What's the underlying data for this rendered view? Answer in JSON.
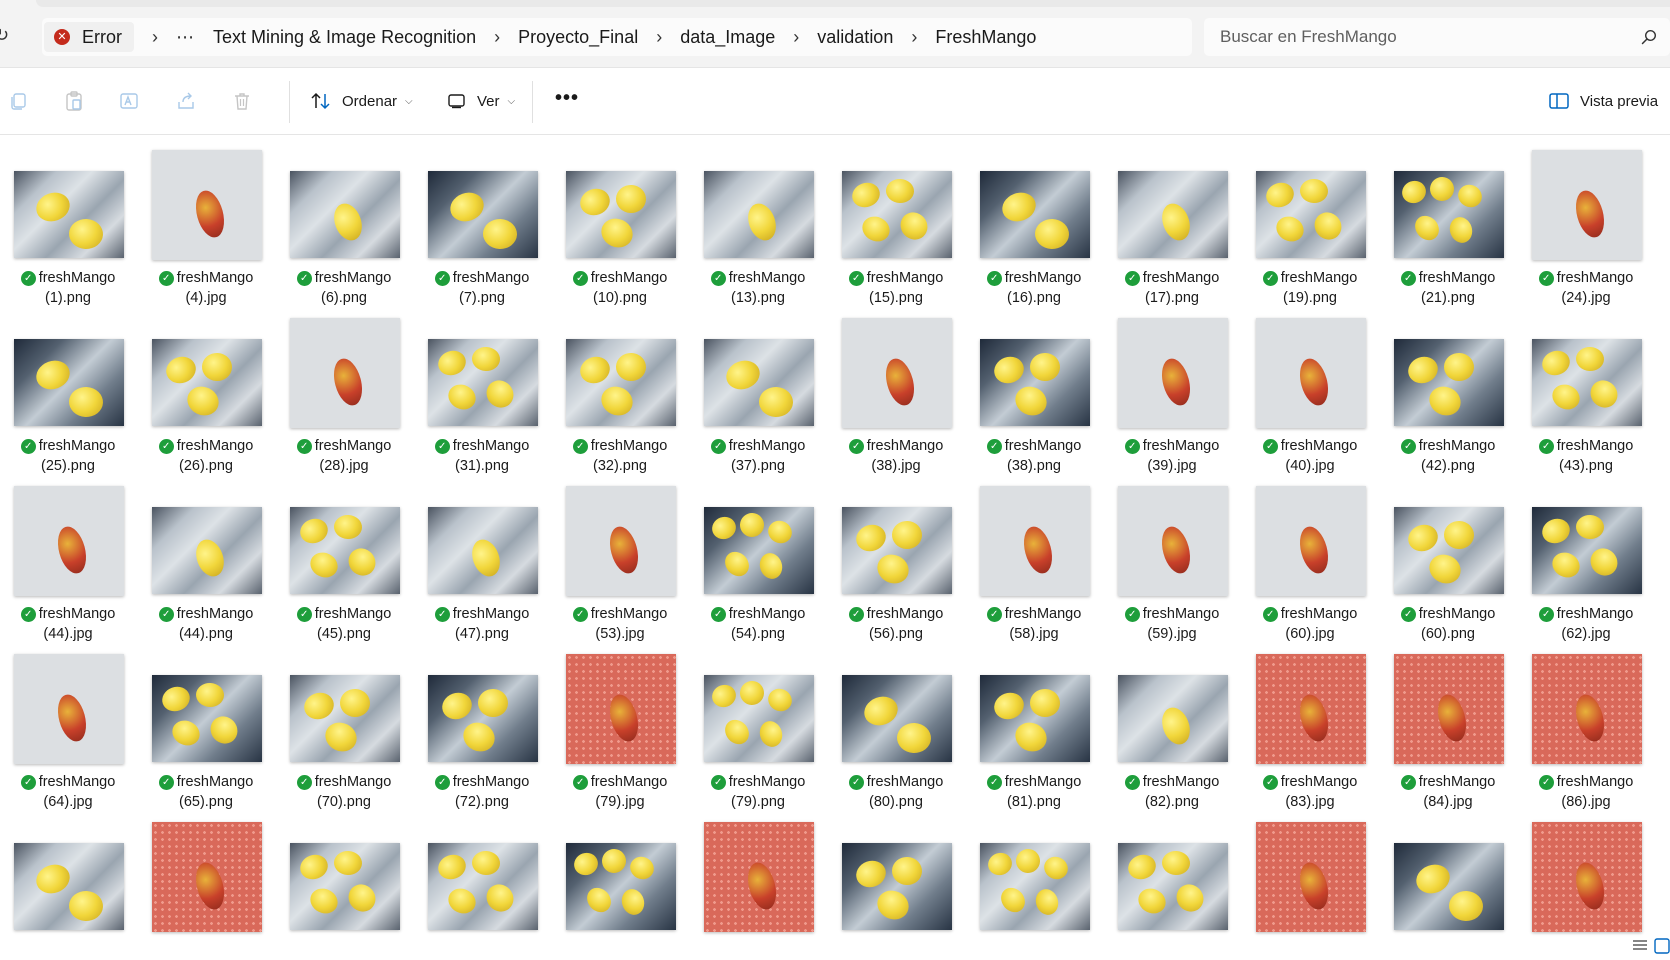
{
  "address_bar": {
    "error_label": "Error",
    "more_label": "⋯",
    "crumbs": [
      "Text Mining & Image Recognition",
      "Proyecto_Final",
      "data_Image",
      "validation",
      "FreshMango"
    ],
    "search_placeholder": "Buscar en FreshMango"
  },
  "command_bar": {
    "sort_label": "Ordenar",
    "view_label": "Ver",
    "more_label": "•••",
    "preview_label": "Vista previa"
  },
  "files": [
    {
      "name": "freshMango",
      "ext": "(1).png",
      "scene": "tray",
      "fruits": 2
    },
    {
      "name": "freshMango",
      "ext": "(4).jpg",
      "scene": "white",
      "fruits": 1
    },
    {
      "name": "freshMango",
      "ext": "(6).png",
      "scene": "tray",
      "fruits": 1
    },
    {
      "name": "freshMango",
      "ext": "(7).png",
      "scene": "tray-dark",
      "fruits": 2
    },
    {
      "name": "freshMango",
      "ext": "(10).png",
      "scene": "tray",
      "fruits": 3
    },
    {
      "name": "freshMango",
      "ext": "(13).png",
      "scene": "tray",
      "fruits": 1
    },
    {
      "name": "freshMango",
      "ext": "(15).png",
      "scene": "tray",
      "fruits": 4
    },
    {
      "name": "freshMango",
      "ext": "(16).png",
      "scene": "tray-dark",
      "fruits": 2
    },
    {
      "name": "freshMango",
      "ext": "(17).png",
      "scene": "tray",
      "fruits": 1
    },
    {
      "name": "freshMango",
      "ext": "(19).png",
      "scene": "tray",
      "fruits": 4
    },
    {
      "name": "freshMango",
      "ext": "(21).png",
      "scene": "tray-dark",
      "fruits": 5
    },
    {
      "name": "freshMango",
      "ext": "(24).jpg",
      "scene": "white",
      "fruits": 1
    },
    {
      "name": "freshMango",
      "ext": "(25).png",
      "scene": "tray-dark",
      "fruits": 2
    },
    {
      "name": "freshMango",
      "ext": "(26).png",
      "scene": "tray",
      "fruits": 3
    },
    {
      "name": "freshMango",
      "ext": "(28).jpg",
      "scene": "white",
      "fruits": 1
    },
    {
      "name": "freshMango",
      "ext": "(31).png",
      "scene": "tray",
      "fruits": 4
    },
    {
      "name": "freshMango",
      "ext": "(32).png",
      "scene": "tray",
      "fruits": 3
    },
    {
      "name": "freshMango",
      "ext": "(37).png",
      "scene": "tray",
      "fruits": 2
    },
    {
      "name": "freshMango",
      "ext": "(38).jpg",
      "scene": "white",
      "fruits": 1
    },
    {
      "name": "freshMango",
      "ext": "(38).png",
      "scene": "tray-dark",
      "fruits": 3
    },
    {
      "name": "freshMango",
      "ext": "(39).jpg",
      "scene": "white",
      "fruits": 1
    },
    {
      "name": "freshMango",
      "ext": "(40).jpg",
      "scene": "white",
      "fruits": 1
    },
    {
      "name": "freshMango",
      "ext": "(42).png",
      "scene": "tray-dark",
      "fruits": 3
    },
    {
      "name": "freshMango",
      "ext": "(43).png",
      "scene": "tray",
      "fruits": 4
    },
    {
      "name": "freshMango",
      "ext": "(44).jpg",
      "scene": "white",
      "fruits": 1
    },
    {
      "name": "freshMango",
      "ext": "(44).png",
      "scene": "tray",
      "fruits": 1
    },
    {
      "name": "freshMango",
      "ext": "(45).png",
      "scene": "tray",
      "fruits": 4
    },
    {
      "name": "freshMango",
      "ext": "(47).png",
      "scene": "tray",
      "fruits": 1
    },
    {
      "name": "freshMango",
      "ext": "(53).jpg",
      "scene": "white",
      "fruits": 1
    },
    {
      "name": "freshMango",
      "ext": "(54).png",
      "scene": "tray-dark",
      "fruits": 5
    },
    {
      "name": "freshMango",
      "ext": "(56).png",
      "scene": "tray",
      "fruits": 3
    },
    {
      "name": "freshMango",
      "ext": "(58).jpg",
      "scene": "white",
      "fruits": 1
    },
    {
      "name": "freshMango",
      "ext": "(59).jpg",
      "scene": "white",
      "fruits": 1
    },
    {
      "name": "freshMango",
      "ext": "(60).jpg",
      "scene": "white",
      "fruits": 1
    },
    {
      "name": "freshMango",
      "ext": "(60).png",
      "scene": "tray",
      "fruits": 3
    },
    {
      "name": "freshMango",
      "ext": "(62).jpg",
      "scene": "tray-dark",
      "fruits": 4
    },
    {
      "name": "freshMango",
      "ext": "(64).jpg",
      "scene": "white",
      "fruits": 1
    },
    {
      "name": "freshMango",
      "ext": "(65).png",
      "scene": "tray-dark",
      "fruits": 4
    },
    {
      "name": "freshMango",
      "ext": "(70).png",
      "scene": "tray",
      "fruits": 3
    },
    {
      "name": "freshMango",
      "ext": "(72).png",
      "scene": "tray-dark",
      "fruits": 3
    },
    {
      "name": "freshMango",
      "ext": "(79).jpg",
      "scene": "red",
      "fruits": 1
    },
    {
      "name": "freshMango",
      "ext": "(79).png",
      "scene": "tray",
      "fruits": 5
    },
    {
      "name": "freshMango",
      "ext": "(80).png",
      "scene": "tray-dark",
      "fruits": 2
    },
    {
      "name": "freshMango",
      "ext": "(81).png",
      "scene": "tray-dark",
      "fruits": 3
    },
    {
      "name": "freshMango",
      "ext": "(82).png",
      "scene": "tray",
      "fruits": 1
    },
    {
      "name": "freshMango",
      "ext": "(83).jpg",
      "scene": "red",
      "fruits": 1
    },
    {
      "name": "freshMango",
      "ext": "(84).jpg",
      "scene": "red",
      "fruits": 1
    },
    {
      "name": "freshMango",
      "ext": "(86).jpg",
      "scene": "red",
      "fruits": 1
    },
    {
      "name": "",
      "ext": "",
      "scene": "tray",
      "fruits": 2
    },
    {
      "name": "",
      "ext": "",
      "scene": "red",
      "fruits": 1
    },
    {
      "name": "",
      "ext": "",
      "scene": "tray",
      "fruits": 4
    },
    {
      "name": "",
      "ext": "",
      "scene": "tray",
      "fruits": 4
    },
    {
      "name": "",
      "ext": "",
      "scene": "tray-dark",
      "fruits": 5
    },
    {
      "name": "",
      "ext": "",
      "scene": "red",
      "fruits": 1
    },
    {
      "name": "",
      "ext": "",
      "scene": "tray-dark",
      "fruits": 3
    },
    {
      "name": "",
      "ext": "",
      "scene": "tray",
      "fruits": 5
    },
    {
      "name": "",
      "ext": "",
      "scene": "tray",
      "fruits": 4
    },
    {
      "name": "",
      "ext": "",
      "scene": "red",
      "fruits": 1
    },
    {
      "name": "",
      "ext": "",
      "scene": "tray-dark",
      "fruits": 2
    },
    {
      "name": "",
      "ext": "",
      "scene": "red",
      "fruits": 1
    }
  ],
  "colors": {
    "accent": "#0067c0",
    "error": "#c42b1c",
    "sync_ok": "#1e9e3b",
    "mango_yellow": "#f1d63a",
    "mango_red": "#c8402a"
  }
}
